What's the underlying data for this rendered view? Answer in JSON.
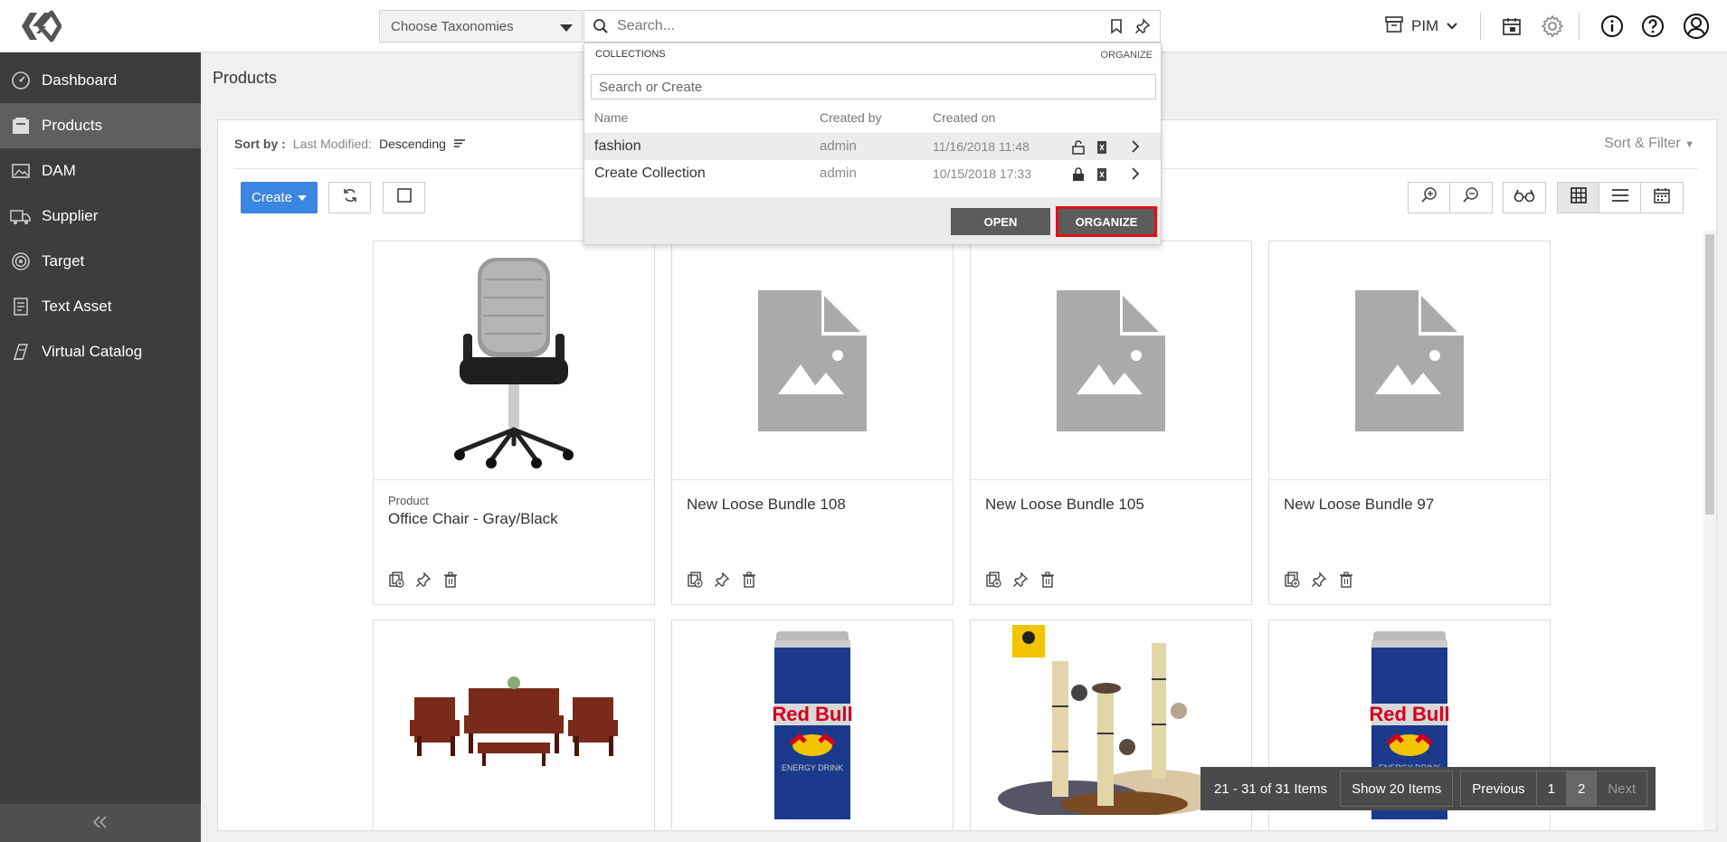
{
  "header": {
    "taxonomy_placeholder": "Choose Taxonomies",
    "search_placeholder": "Search...",
    "workspace": "PIM"
  },
  "sidebar": {
    "items": [
      {
        "label": "Dashboard",
        "icon": "speedometer-icon"
      },
      {
        "label": "Products",
        "icon": "products-icon"
      },
      {
        "label": "DAM",
        "icon": "image-icon"
      },
      {
        "label": "Supplier",
        "icon": "truck-icon"
      },
      {
        "label": "Target",
        "icon": "target-icon"
      },
      {
        "label": "Text Asset",
        "icon": "text-doc-icon"
      },
      {
        "label": "Virtual Catalog",
        "icon": "catalog-icon"
      }
    ],
    "active": "Products"
  },
  "page": {
    "title": "Products",
    "sort_by_label": "Sort by :",
    "sort_field": "Last Modified:",
    "sort_order": "Descending",
    "sort_filter": "Sort & Filter",
    "create_label": "Create"
  },
  "cards": [
    {
      "type": "Product",
      "name": "Office Chair - Gray/Black",
      "image": "chair"
    },
    {
      "type": "",
      "name": "New Loose Bundle 108",
      "image": "placeholder"
    },
    {
      "type": "",
      "name": "New Loose Bundle 105",
      "image": "placeholder"
    },
    {
      "type": "",
      "name": "New Loose Bundle 97",
      "image": "placeholder"
    },
    {
      "type": "",
      "name": "",
      "image": "furniture"
    },
    {
      "type": "",
      "name": "",
      "image": "redbull"
    },
    {
      "type": "",
      "name": "",
      "image": "cat-tree"
    },
    {
      "type": "",
      "name": "",
      "image": "redbull"
    }
  ],
  "collections": {
    "heading": "COLLECTIONS",
    "organize_link": "ORGANIZE",
    "search_placeholder": "Search or Create",
    "columns": [
      "Name",
      "Created by",
      "Created on"
    ],
    "rows": [
      {
        "name": "fashion",
        "created_by": "admin",
        "created_on": "11/16/2018 11:48"
      },
      {
        "name": "Create Collection",
        "created_by": "admin",
        "created_on": "10/15/2018 17:33"
      }
    ],
    "open_label": "OPEN",
    "organize_label": "ORGANIZE"
  },
  "pagination": {
    "range": "21 - 31 of 31 Items",
    "show": "Show 20 Items",
    "previous": "Previous",
    "pages": [
      "1",
      "2"
    ],
    "current": "2",
    "next": "Next"
  },
  "colors": {
    "sidebar": "#3d3d3d",
    "accent": "#3b86e0",
    "highlight_border": "#e0101a"
  }
}
